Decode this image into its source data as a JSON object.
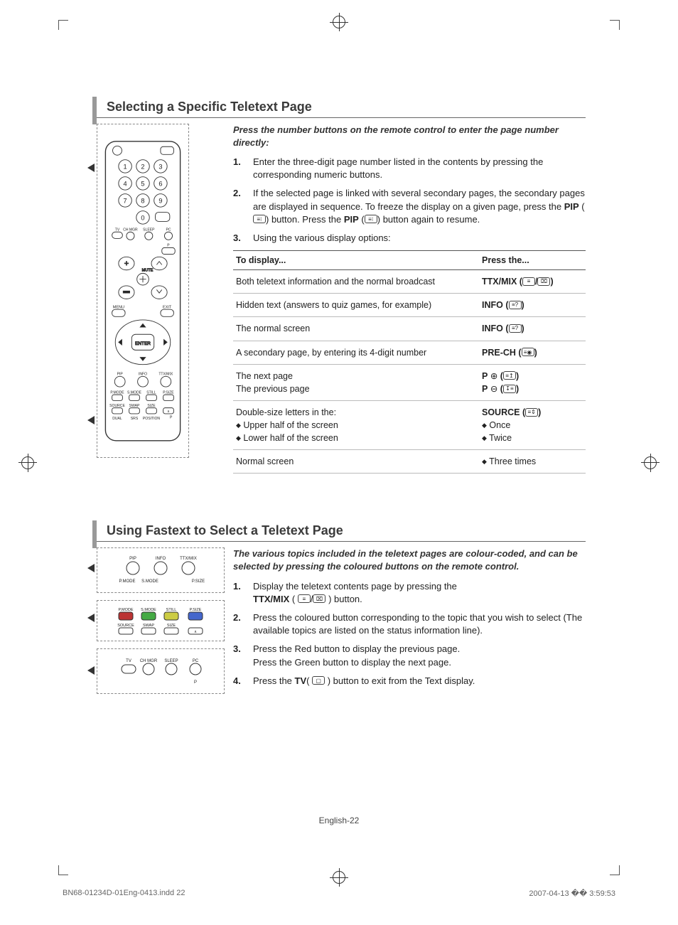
{
  "page_footer": "English-22",
  "meta": {
    "file": "BN68-01234D-01Eng-0413.indd   22",
    "date": "2007-04-13   �� 3:59:53"
  },
  "section1": {
    "title": "Selecting a Specific Teletext Page",
    "intro": "Press the number buttons on the remote control to enter the page number directly:",
    "steps": [
      {
        "num": "1.",
        "text": "Enter the three-digit page number listed in the contents by pressing the corresponding numeric buttons."
      },
      {
        "num": "2.",
        "pre": "If the selected page is linked with several secondary pages, the secondary pages are displayed in sequence. To freeze the display on a given page, press the ",
        "b1": "PIP",
        "mid1": " (",
        "icon1": "hold-icon",
        "mid2": ") button. Press the ",
        "b2": "PIP",
        "mid3": " (",
        "icon2": "hold-icon",
        "post": ") button again to resume."
      },
      {
        "num": "3.",
        "text": "Using the various display options:"
      }
    ],
    "table": {
      "headers": [
        "To display...",
        "Press the..."
      ],
      "rows": [
        {
          "display": "Both teletext information and the normal broadcast",
          "press_b": "TTX/MIX",
          "press_after": " (",
          "icons": [
            "ttx-icon",
            "mix-icon"
          ],
          "press_close": ")"
        },
        {
          "display": "Hidden text (answers to quiz games, for example)",
          "press_b": "INFO",
          "press_after": " (",
          "icons": [
            "reveal-icon"
          ],
          "press_close": ")"
        },
        {
          "display": "The normal screen",
          "press_b": "INFO",
          "press_after": " (",
          "icons": [
            "reveal-icon"
          ],
          "press_close": ")"
        },
        {
          "display": "A secondary page, by entering its 4-digit number",
          "press_b": "PRE-CH",
          "press_after": " (",
          "icons": [
            "subpage-icon"
          ],
          "press_close": ")"
        },
        {
          "display_multi": [
            "The next page",
            "The previous page"
          ],
          "press_multi": [
            {
              "b": "P",
              "sym": "⊕",
              "icons": [
                "pageup-icon"
              ]
            },
            {
              "b": "P",
              "sym": "⊖",
              "icons": [
                "pagedown-icon"
              ]
            }
          ]
        },
        {
          "display_multi": [
            "Double-size letters in the:",
            "◆ Upper half of the screen",
            "◆ Lower half of the screen"
          ],
          "press_multi_plain": [
            {
              "b": "SOURCE",
              "icons": [
                "size-icon"
              ]
            },
            "◆ Once",
            "◆ Twice"
          ]
        },
        {
          "display": "Normal screen",
          "press_plain": "◆ Three times"
        }
      ]
    }
  },
  "section2": {
    "title": "Using Fastext to Select a Teletext Page",
    "intro": "The various topics included in the teletext pages are colour-coded, and can be selected by pressing the coloured buttons on the remote control.",
    "steps": [
      {
        "num": "1.",
        "pre": "Display the teletext contents page by pressing the ",
        "nl": true,
        "b1": "TTX/MIX",
        "mid1": " ( ",
        "icons": [
          "ttx-icon",
          "mix-icon"
        ],
        "post": " ) button."
      },
      {
        "num": "2.",
        "text": "Press the coloured button corresponding to the topic that you wish to select (The available topics are listed on the status information line)."
      },
      {
        "num": "3.",
        "text_multi": [
          "Press the Red button to display the previous page.",
          "Press the Green button to display the next page."
        ]
      },
      {
        "num": "4.",
        "pre": "Press the ",
        "b1": "TV",
        "mid1": "( ",
        "icons": [
          "tv-icon"
        ],
        "post": " ) button to exit from the Text display."
      }
    ]
  },
  "remote_labels": {
    "tv": "TV",
    "ch": "CH",
    "mgr": "MGR",
    "sleep": "SLEEP",
    "pc": "PC",
    "p": "P",
    "mute": "MUTE",
    "menu": "MENU",
    "exit": "EXIT",
    "enter": "ENTER",
    "pip": "PIP",
    "info": "INFO",
    "ttxmix": "TTX/MIX",
    "pmode": "P.MODE",
    "smode": "S.MODE",
    "still": "STILL",
    "psize": "P.SIZE",
    "source": "SOURCE",
    "swap": "SWAP",
    "size": "SIZE",
    "dual": "DUAL",
    "srs": "SRS",
    "position": "POSITION",
    "prech": "PRE-CH"
  }
}
